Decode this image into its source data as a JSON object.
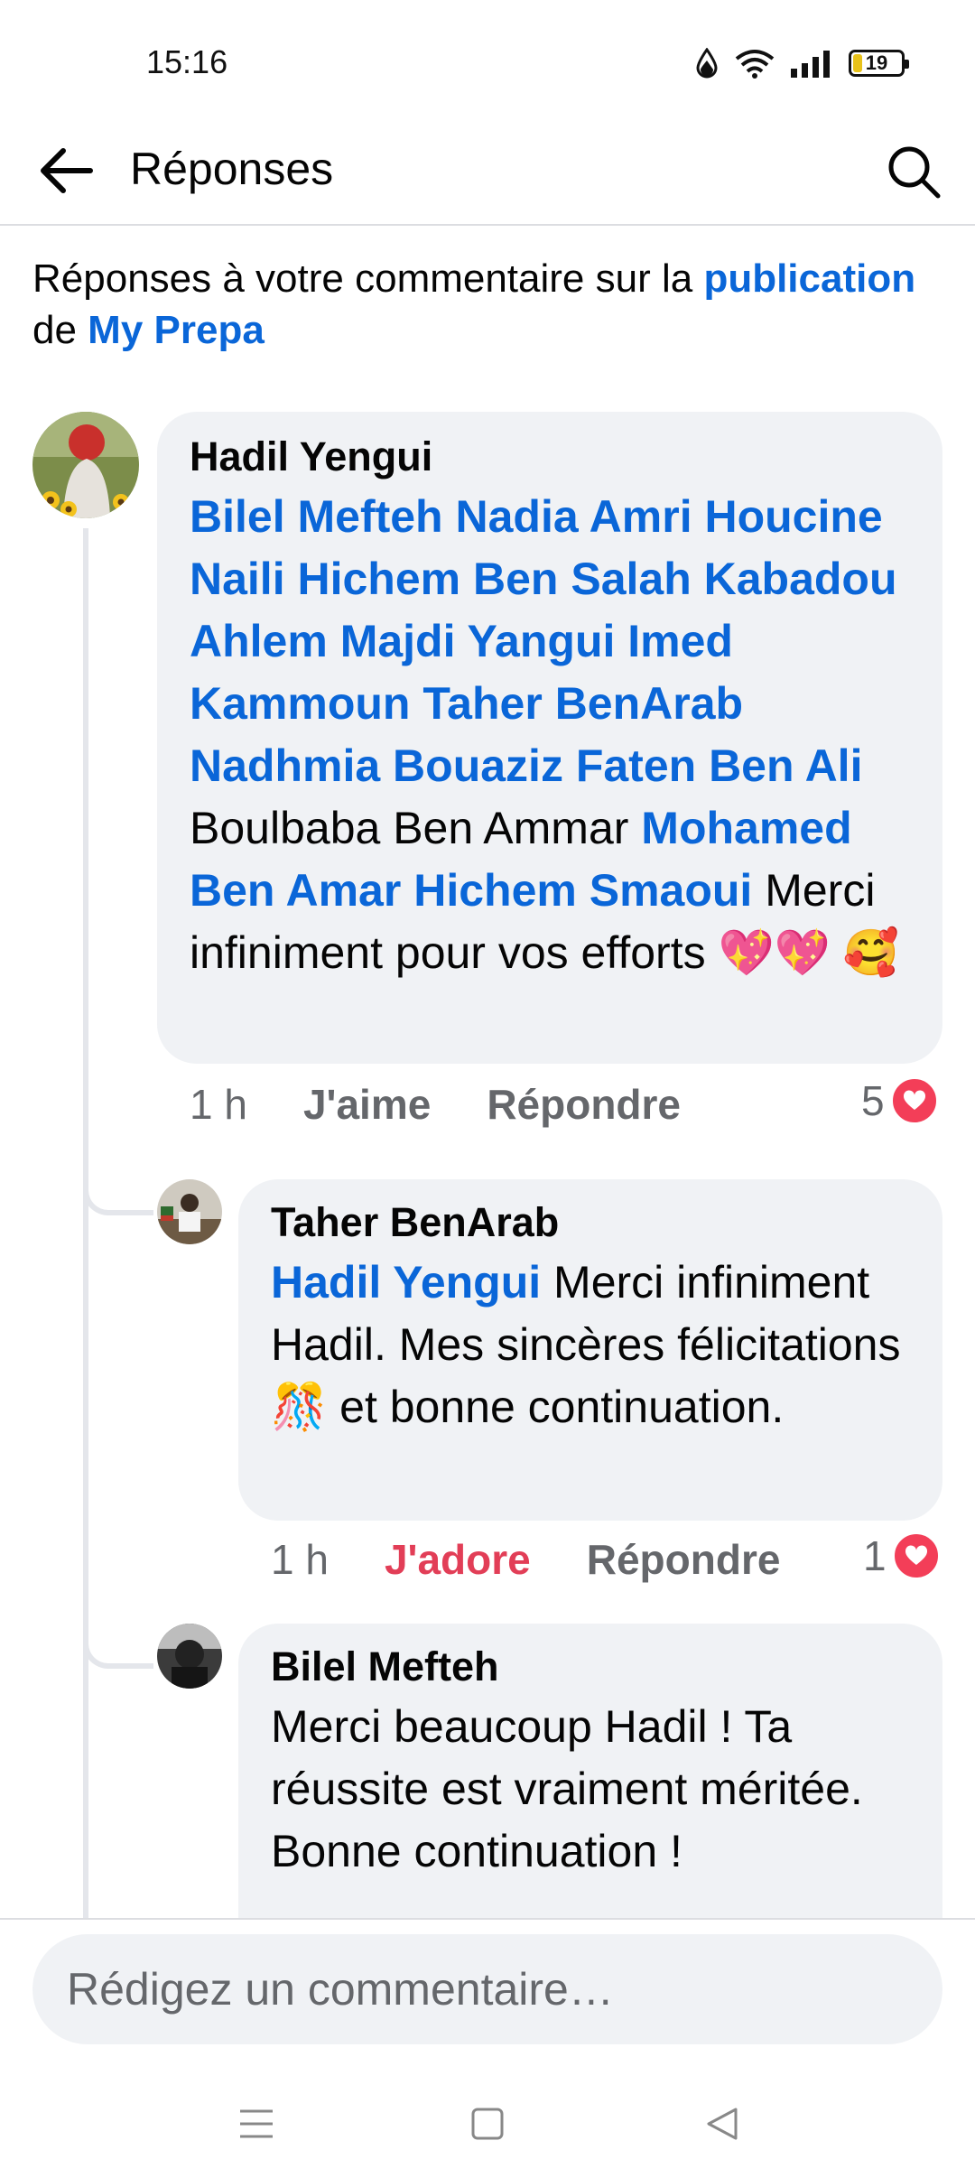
{
  "status": {
    "time": "15:16",
    "battery": "19",
    "battery_level": 0.19
  },
  "header": {
    "title": "Réponses"
  },
  "context": {
    "prefix": "Réponses à votre commentaire sur la ",
    "link1": "publication",
    "middle": " de ",
    "link2": "My Prepa"
  },
  "comments": [
    {
      "author": "Hadil Yengui",
      "segments": [
        {
          "t": "Bilel Mefteh Nadia Amri Houcine Naili Hichem Ben Salah Kabadou Ahlem Majdi Yangui Imed Kammoun Taher BenArab Nadhmia Bouaziz Faten Ben Ali",
          "m": true
        },
        {
          "t": " Boulbaba Ben Ammar ",
          "m": false
        },
        {
          "t": "Mohamed Ben Amar Hichem Smaoui",
          "m": true
        },
        {
          "t": " Merci infiniment pour vos efforts ",
          "m": false
        },
        {
          "t": "💖💖 🥰",
          "m": false
        }
      ],
      "time": "1 h",
      "like_label": "J'aime",
      "reply_label": "Répondre",
      "reaction_count": "5"
    },
    {
      "author": "Taher BenArab",
      "segments": [
        {
          "t": "Hadil Yengui",
          "m": true
        },
        {
          "t": " Merci infiniment Hadil. Mes sincères félicitations 🎊 et bonne continuation.",
          "m": false
        }
      ],
      "time": "1 h",
      "like_label": "J'adore",
      "reply_label": "Répondre",
      "reaction_count": "1"
    },
    {
      "author": "Bilel Mefteh",
      "segments": [
        {
          "t": "Merci beaucoup Hadil ! Ta réussite est vraiment méritée. Bonne continuation !",
          "m": false
        }
      ]
    }
  ],
  "composer": {
    "placeholder": "Rédigez un commentaire…"
  },
  "colors": {
    "link": "#0a66d8",
    "love": "#e23e57",
    "heart": "#f33e58",
    "bubble": "#f0f2f5"
  }
}
